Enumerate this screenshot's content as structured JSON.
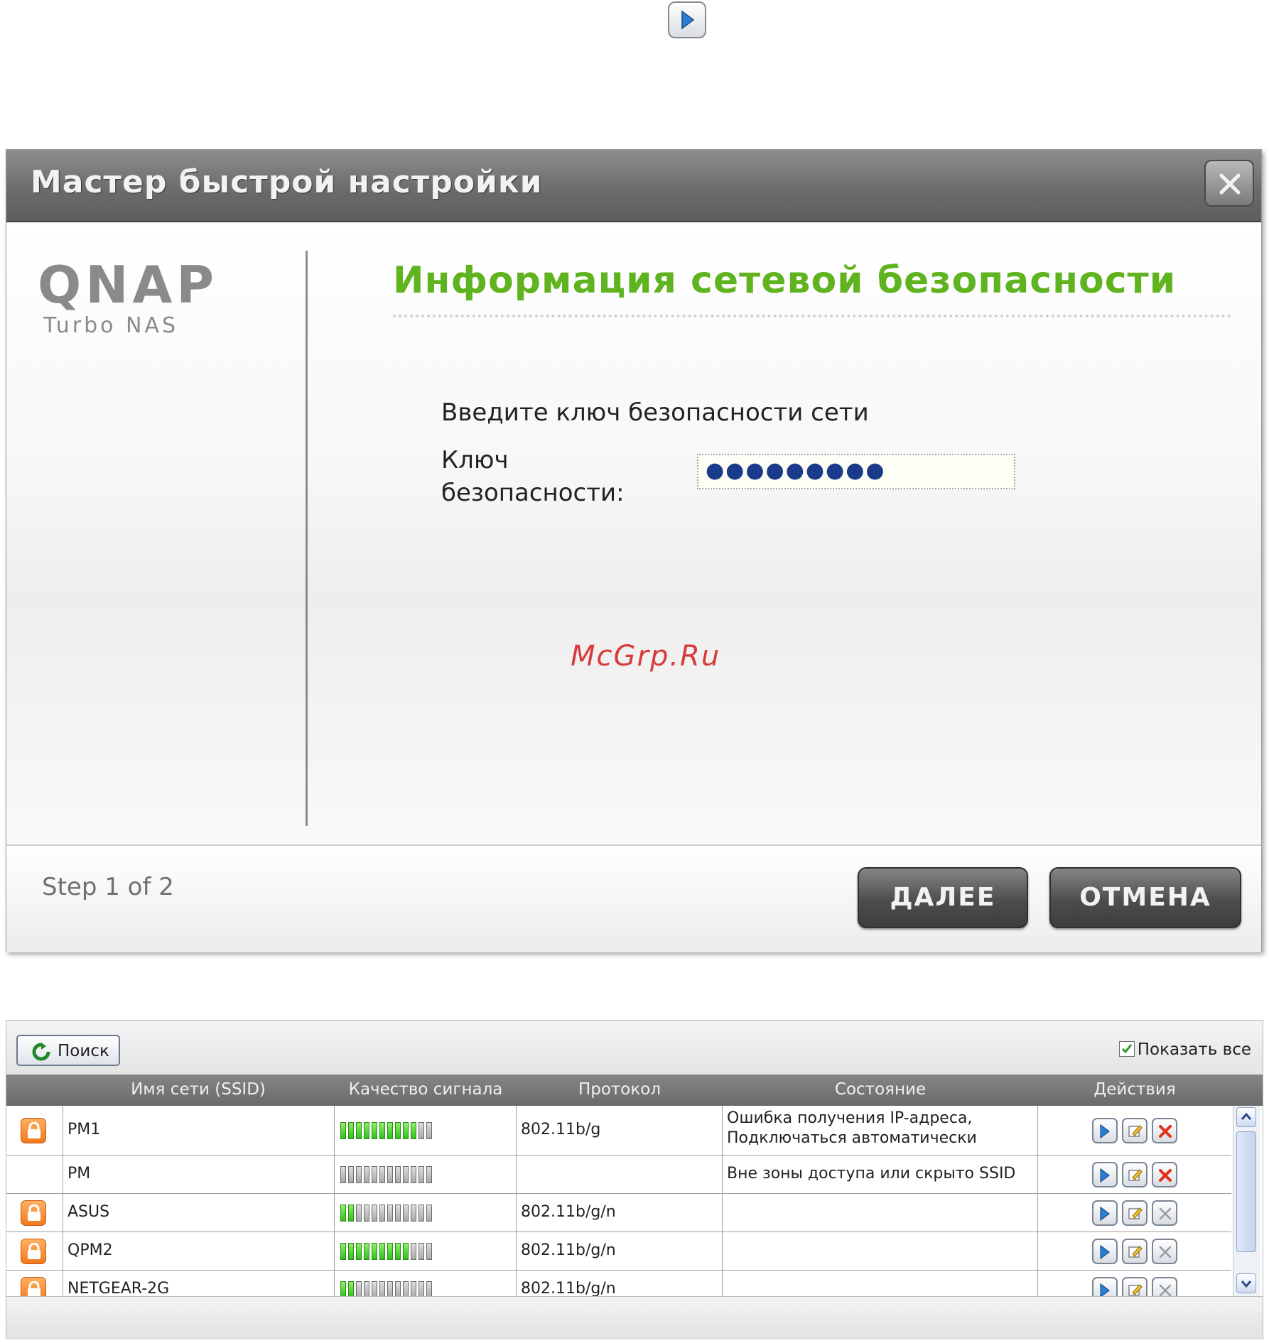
{
  "wizard": {
    "title": "Мастер быстрой настройки",
    "logo_main": "QNAP",
    "logo_sub": "Turbo NAS",
    "heading": "Информация сетевой безопасности",
    "prompt": "Введите ключ безопасности сети",
    "key_label": "Ключ безопасности:",
    "key_value": "●●●●●●●●●",
    "watermark": "McGrp.Ru",
    "step": "Step 1 of 2",
    "next_label": "ДАЛЕЕ",
    "cancel_label": "ОТМЕНА",
    "heading_color": "#5fb31f"
  },
  "wifi": {
    "search_label": "Поиск",
    "show_all_label": "Показать все",
    "show_all_checked": true,
    "columns": [
      "Имя сети (SSID)",
      "Качество сигнала",
      "Протокол",
      "Состояние",
      "Действия"
    ],
    "rows": [
      {
        "locked": true,
        "ssid": "PM1",
        "signal": 10,
        "protocol": "802.11b/g",
        "status": "Ошибка получения IP-адреса,",
        "status2": "Подключаться автоматически",
        "delete_active": true
      },
      {
        "locked": false,
        "ssid": "PM",
        "signal": 0,
        "protocol": "",
        "status": "Вне зоны доступа или скрыто SSID",
        "status2": "",
        "delete_active": true
      },
      {
        "locked": true,
        "ssid": "ASUS",
        "signal": 2,
        "protocol": "802.11b/g/n",
        "status": "",
        "status2": "",
        "delete_active": false
      },
      {
        "locked": true,
        "ssid": "QPM2",
        "signal": 9,
        "protocol": "802.11b/g/n",
        "status": "",
        "status2": "",
        "delete_active": false
      },
      {
        "locked": true,
        "ssid": "NETGEAR-2G",
        "signal": 2,
        "protocol": "802.11b/g/n",
        "status": "",
        "status2": "",
        "delete_active": false
      }
    ]
  }
}
